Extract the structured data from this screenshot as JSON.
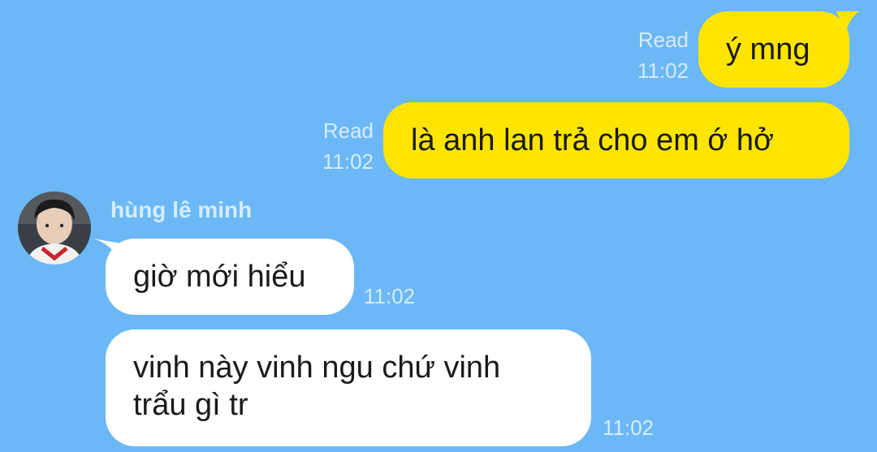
{
  "theme": {
    "background": "#6cb8f6",
    "outgoing_bubble": "#fee500",
    "incoming_bubble": "#ffffff",
    "meta_text": "#d6ecfd"
  },
  "contact": {
    "name": "hùng lê minh",
    "avatar_icon": "user-photo"
  },
  "messages": [
    {
      "direction": "outgoing",
      "text": "ý mng",
      "status": "Read",
      "time": "11:02"
    },
    {
      "direction": "outgoing",
      "text": "là anh lan trả cho em ớ hở",
      "status": "Read",
      "time": "11:02"
    },
    {
      "direction": "incoming",
      "text": "giờ mới hiểu",
      "time": "11:02"
    },
    {
      "direction": "incoming",
      "text": "vinh này vinh ngu chứ vinh trẩu gì tr",
      "text_line1": "vinh này vinh ngu chứ vinh",
      "text_line2": "trẩu gì tr",
      "time": "11:02"
    }
  ]
}
